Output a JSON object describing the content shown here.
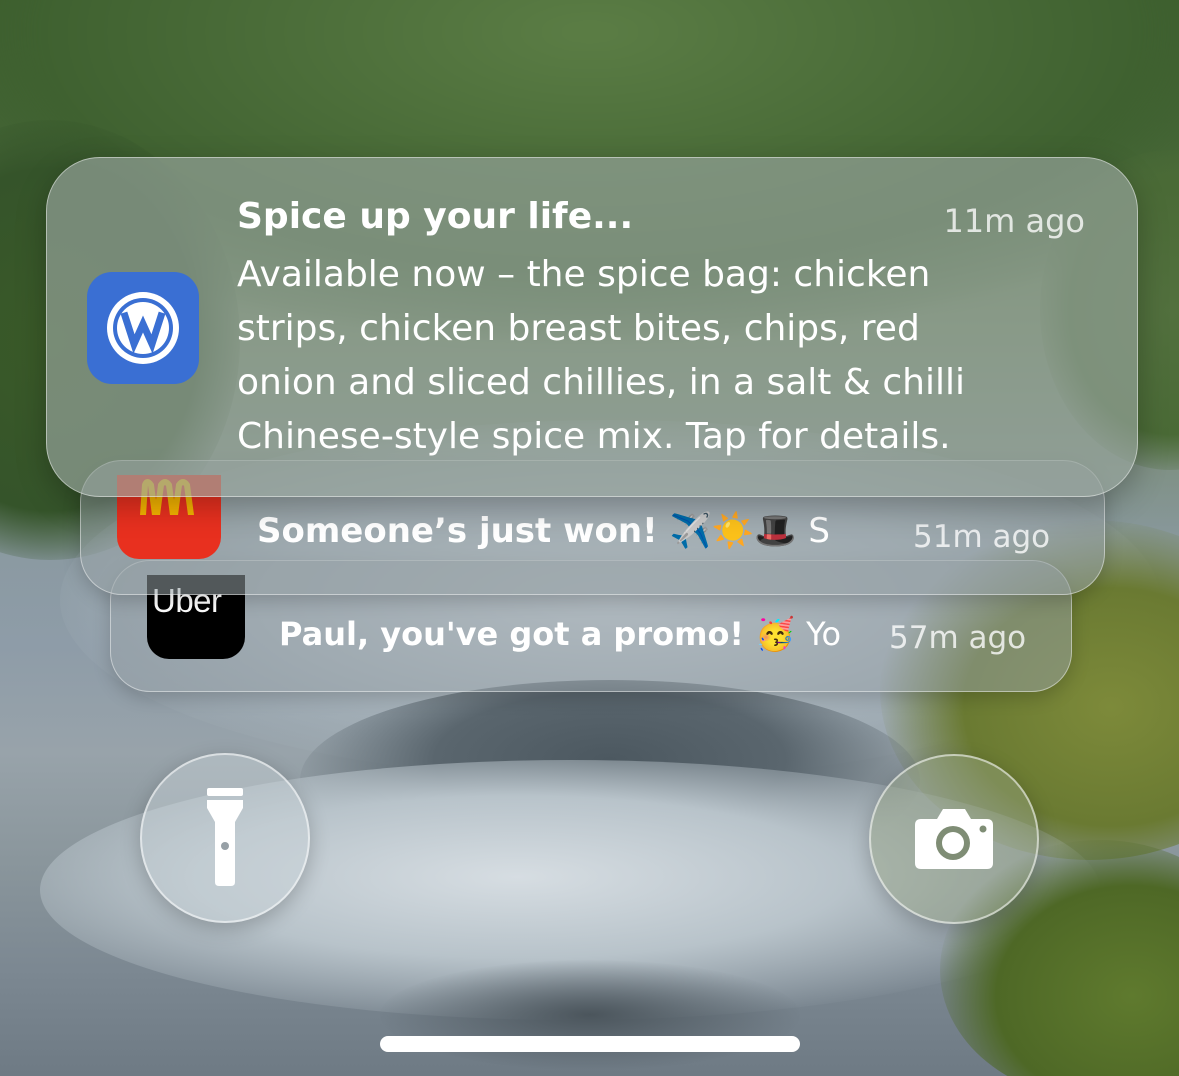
{
  "notifications": [
    {
      "app_icon": "wetherspoon-app-icon",
      "title": "Spice up your life...",
      "time": "11m ago",
      "body_lines": [
        "Available now – the spice bag: chicken",
        "strips, chicken breast bites, chips, red",
        "onion and sliced chillies, in a salt & chilli",
        "Chinese-style spice mix. Tap for details."
      ]
    },
    {
      "app_icon": "mcdonalds-app-icon",
      "title": "Someone’s just won!",
      "emojis": "✈️☀️🎩",
      "truncated": "S",
      "time": "51m ago"
    },
    {
      "app_icon": "uber-app-icon",
      "app_label": "Uber",
      "title": "Paul, you've got a promo!",
      "emojis": "🥳",
      "truncated": "Yo",
      "time": "57m ago"
    }
  ],
  "controls": {
    "left_button_icon": "flashlight-icon",
    "right_button_icon": "camera-icon"
  },
  "colors": {
    "wetherspoon_blue": "#3a6fd3",
    "mcdonalds_red": "#e8301f",
    "mcdonalds_gold": "#f5b400",
    "uber_black": "#000000"
  }
}
